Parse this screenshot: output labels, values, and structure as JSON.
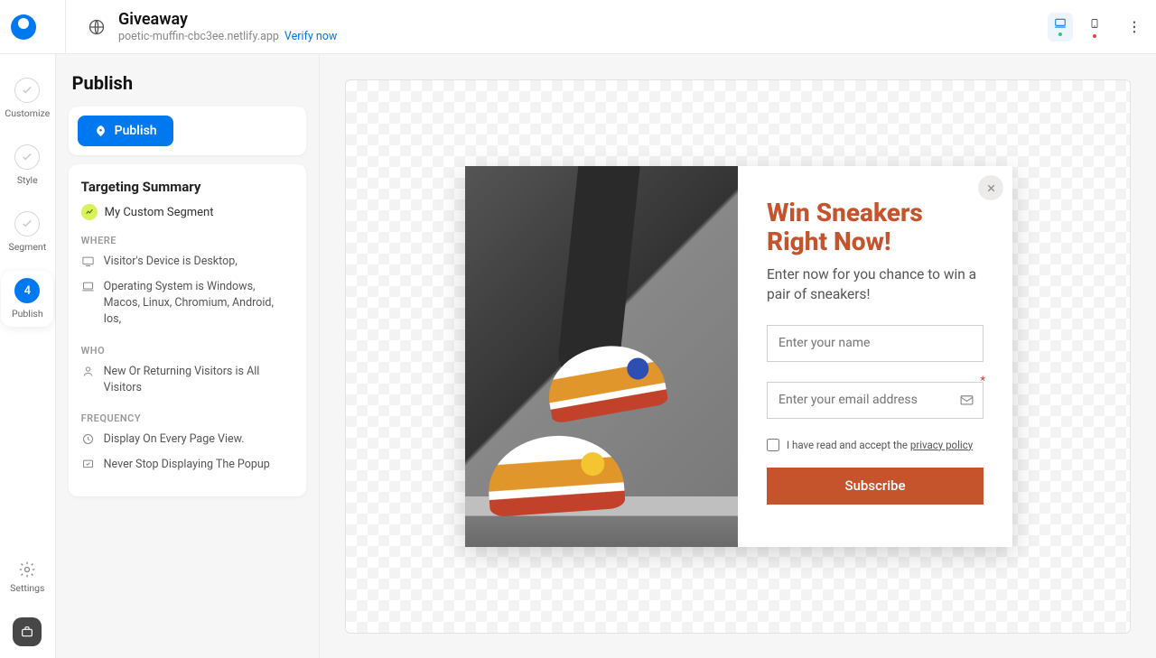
{
  "header": {
    "title": "Giveaway",
    "domain": "poetic-muffin-cbc3ee.netlify.app",
    "verify_label": "Verify now"
  },
  "nav": {
    "steps": [
      {
        "label": "Customize"
      },
      {
        "label": "Style"
      },
      {
        "label": "Segment"
      },
      {
        "label": "Publish",
        "number": "4"
      }
    ],
    "settings_label": "Settings"
  },
  "panel": {
    "title": "Publish",
    "publish_btn": "Publish",
    "summary_title": "Targeting Summary",
    "segment_name": "My Custom Segment",
    "where_label": "WHERE",
    "where_rules": [
      "Visitor's Device is Desktop,",
      "Operating System is Windows, Macos, Linux, Chromium, Android, Ios,"
    ],
    "who_label": "WHO",
    "who_rules": [
      "New Or Returning Visitors is All Visitors"
    ],
    "freq_label": "FREQUENCY",
    "freq_rules": [
      "Display On Every Page View.",
      "Never Stop Displaying The Popup"
    ]
  },
  "popup": {
    "headline": "Win Sneakers Right Now!",
    "subtext": "Enter now for you chance to win a pair of sneakers!",
    "name_placeholder": "Enter your name",
    "email_placeholder": "Enter your email address",
    "consent_prefix": "I have read and accept the ",
    "consent_link": "privacy policy",
    "subscribe_label": "Subscribe"
  }
}
